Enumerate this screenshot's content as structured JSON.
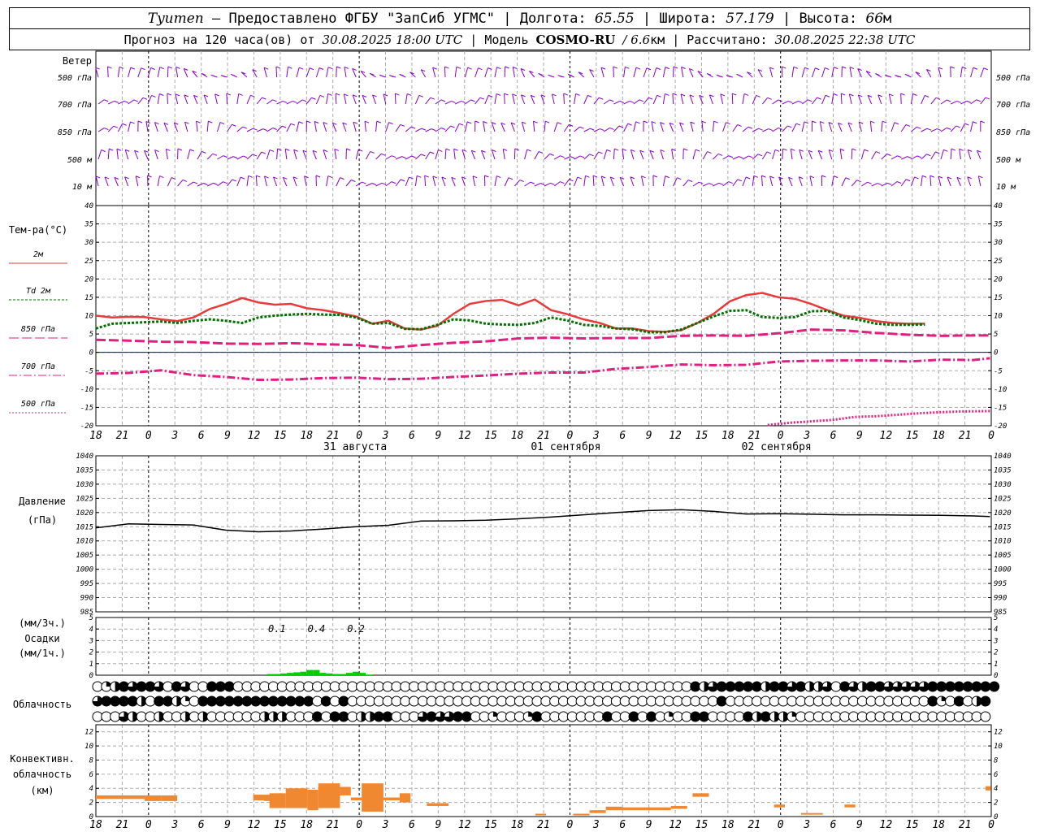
{
  "header": {
    "station": "Tyumen",
    "provider": "– Предоставлено ФГБУ \"ЗапСиб УГМС\"",
    "sep": "|",
    "lon_label": "Долгота:",
    "lon_value": "65.55",
    "lat_label": "Широта:",
    "lat_value": "57.179",
    "alt_label": "Высота:",
    "alt_value": "66",
    "alt_unit": "м",
    "forecast_label": "Прогноз на 120 часа(ов) от",
    "forecast_start": "30.08.2025 18:00 UTC",
    "model_label": "Модель",
    "model_name": "COSMO-RU",
    "model_res": "/ 6.6",
    "model_res_unit": "км",
    "calc_label": "Рассчитано:",
    "calc_time": "30.08.2025 22:38 UTC"
  },
  "colors": {
    "wind": "#8800cc",
    "t2m": "#e83a3a",
    "td2m": "#007000",
    "t850": "#e0207e",
    "t700": "#e0207e",
    "t500": "#e0207e",
    "zero_line": "#0000cc",
    "pressure": "#000000",
    "precip": "#00cc00",
    "conv": "#f08832",
    "grid": "#aaaaaa"
  },
  "chart_data": {
    "type": "line",
    "time_axis": {
      "start": "30.08.2025 18:00 UTC",
      "step_hours": 3,
      "tick_labels": [
        "18",
        "21",
        "0",
        "3",
        "6",
        "9",
        "12",
        "15",
        "18",
        "21",
        "0",
        "3",
        "6",
        "9",
        "12",
        "15",
        "18",
        "21",
        "0",
        "3",
        "6",
        "9",
        "12",
        "15",
        "18",
        "21",
        "0",
        "3",
        "6",
        "9",
        "12",
        "15",
        "18",
        "21",
        "0"
      ],
      "day_labels": [
        {
          "tick_index": 10,
          "text": "31 августа"
        },
        {
          "tick_index": 18,
          "text": "01 сентября"
        },
        {
          "tick_index": 26,
          "text": "02 сентября"
        }
      ],
      "hourly_x": [
        0,
        2,
        4,
        6,
        8,
        10,
        12,
        14,
        16,
        18,
        20,
        22,
        24,
        26,
        28,
        30,
        32,
        34,
        36,
        38,
        40,
        42,
        44,
        46,
        48,
        50,
        52,
        54,
        56,
        58,
        60,
        62,
        64,
        66,
        68,
        70,
        72,
        74,
        76,
        78,
        80,
        82,
        84,
        86,
        88,
        90,
        92,
        94,
        96,
        98,
        100,
        102,
        104,
        106,
        108,
        110,
        112,
        114,
        116,
        118,
        120,
        122,
        124,
        126,
        128,
        130,
        132,
        134,
        136,
        138,
        140,
        142,
        144,
        146,
        148,
        150,
        152,
        154,
        156,
        158
      ],
      "x_unit": "hours from start"
    },
    "wind": {
      "label": "Ветер",
      "levels": [
        "500 гПа",
        "700 гПа",
        "850 гПа",
        "500 м",
        "10   м"
      ]
    },
    "temperature": {
      "label": "Тем-ра(°C)",
      "ylim": [
        -20,
        40
      ],
      "yticks": [
        -20,
        -15,
        -10,
        -5,
        0,
        5,
        10,
        15,
        20,
        25,
        30,
        35,
        40
      ],
      "series": [
        {
          "name": "2м",
          "style": "solid",
          "x": [
            0,
            3,
            6,
            9,
            12,
            15,
            18,
            21,
            24,
            27,
            30,
            33,
            36,
            39,
            42,
            45,
            48,
            51,
            54,
            57,
            60,
            63,
            66,
            69,
            72,
            75,
            78,
            81,
            84,
            87,
            90,
            93,
            96,
            99,
            102,
            105,
            108,
            111,
            114,
            117,
            120,
            123,
            126,
            129,
            132,
            135,
            138,
            141,
            144,
            147,
            150,
            153,
            156,
            159,
            162,
            165
          ],
          "y": [
            10,
            9.5,
            9.7,
            9.6,
            9,
            8.5,
            9.5,
            11.8,
            13.2,
            14.8,
            13.6,
            13,
            13.2,
            12,
            11.5,
            10.7,
            9.8,
            7.8,
            8.6,
            6.5,
            6.2,
            7.2,
            10.5,
            13.2,
            14,
            14.3,
            12.8,
            14.4,
            11.5,
            10.4,
            9,
            8,
            6.5,
            6.5,
            5.8,
            5.6,
            6,
            8,
            10.5,
            13.9,
            15.6,
            16.2,
            15,
            14.6,
            13.2,
            11.5,
            10,
            9.4,
            8.5,
            8,
            7.8,
            7.8
          ]
        },
        {
          "name": "Td 2м",
          "style": "dotted",
          "x": [
            0,
            3,
            6,
            9,
            12,
            15,
            18,
            21,
            24,
            27,
            30,
            33,
            36,
            39,
            42,
            45,
            48,
            51,
            54,
            57,
            60,
            63,
            66,
            69,
            72,
            75,
            78,
            81,
            84,
            87,
            90,
            93,
            96,
            99,
            102,
            105,
            108,
            111,
            114,
            117,
            120,
            123,
            126,
            129,
            132,
            135,
            138,
            141,
            144,
            147,
            150,
            153,
            156,
            159,
            162,
            165
          ],
          "y": [
            6.5,
            7.8,
            8,
            8.2,
            8.4,
            8,
            8.6,
            9,
            8.6,
            8,
            9.5,
            10,
            10.3,
            10.5,
            10.3,
            10.2,
            9.5,
            7.8,
            8,
            6.4,
            6.3,
            7.5,
            9,
            8.7,
            7.8,
            7.6,
            7.5,
            8,
            9.5,
            8.7,
            7.5,
            7.2,
            6.5,
            6.3,
            5.5,
            5.5,
            6.2,
            8,
            9.8,
            11.3,
            11.5,
            9.6,
            9.4,
            9.6,
            11.2,
            11.3,
            9.5,
            8.8,
            7.8,
            7.5,
            7.5,
            7.6
          ]
        },
        {
          "name": "850 гПа",
          "style": "long-dash",
          "x": [
            0,
            6,
            12,
            18,
            24,
            30,
            36,
            42,
            48,
            54,
            60,
            66,
            72,
            78,
            84,
            90,
            96,
            102,
            108,
            114,
            120,
            126,
            132,
            138,
            144,
            150,
            156,
            162,
            165
          ],
          "y": [
            3.4,
            3.2,
            2.9,
            2.8,
            2.4,
            2.3,
            2.5,
            2.2,
            2.0,
            1.2,
            2.0,
            2.6,
            3.0,
            3.8,
            4.0,
            3.8,
            3.9,
            3.9,
            4.5,
            4.6,
            4.5,
            5.2,
            6.2,
            6.0,
            5.3,
            4.8,
            4.5,
            4.6,
            4.6
          ]
        },
        {
          "name": "700 гПа",
          "style": "dash-dot",
          "x": [
            0,
            6,
            12,
            18,
            24,
            30,
            36,
            42,
            48,
            54,
            60,
            66,
            72,
            78,
            84,
            90,
            96,
            102,
            108,
            114,
            120,
            126,
            132,
            138,
            144,
            150,
            156,
            162,
            165
          ],
          "y": [
            -5.8,
            -5.6,
            -4.9,
            -6.2,
            -6.7,
            -7.5,
            -7.4,
            -7.0,
            -6.9,
            -7.3,
            -7.2,
            -6.7,
            -6.3,
            -5.8,
            -5.5,
            -5.5,
            -4.5,
            -4.0,
            -3.3,
            -3.5,
            -3.4,
            -2.5,
            -2.3,
            -2.2,
            -2.2,
            -2.5,
            -2.0,
            -2.1,
            -1.6
          ]
        },
        {
          "name": "500 гПа",
          "style": "dotted",
          "x": [
            124,
            128,
            132,
            136,
            140,
            144,
            148,
            152,
            156,
            160,
            165
          ],
          "y": [
            -19.8,
            -19.2,
            -18.8,
            -18.4,
            -17.6,
            -17.4,
            -17.0,
            -16.6,
            -16.3,
            -16.1,
            -16.0
          ]
        }
      ]
    },
    "pressure": {
      "label": "Давление",
      "unit": "(гПа)",
      "ylim": [
        985,
        1040
      ],
      "yticks": [
        985,
        990,
        995,
        1000,
        1005,
        1010,
        1015,
        1020,
        1025,
        1030,
        1035,
        1040
      ],
      "x": [
        0,
        6,
        12,
        18,
        24,
        30,
        36,
        42,
        48,
        54,
        60,
        66,
        72,
        78,
        84,
        90,
        96,
        102,
        108,
        114,
        120,
        126,
        132,
        138,
        144,
        150,
        156,
        162,
        165
      ],
      "y": [
        1014.6,
        1016.0,
        1015.8,
        1015.6,
        1013.8,
        1013.2,
        1013.5,
        1014.2,
        1015.0,
        1015.5,
        1017.0,
        1017.1,
        1017.3,
        1017.8,
        1018.4,
        1019.2,
        1020.0,
        1020.7,
        1021.0,
        1020.4,
        1019.5,
        1019.6,
        1019.4,
        1019.2,
        1019.2,
        1019.1,
        1019.0,
        1018.8,
        1018.6
      ]
    },
    "precip": {
      "unit_3h": "(мм/3ч.)",
      "label": "Осадки",
      "unit_1h": "(мм/1ч.)",
      "ylim": [
        0,
        5
      ],
      "yticks": [
        0,
        1,
        2,
        3,
        4,
        5
      ],
      "totals": [
        {
          "x": 27,
          "text": "0.1"
        },
        {
          "x": 33,
          "text": "0.4"
        },
        {
          "x": 39,
          "text": "0.2"
        }
      ],
      "x": [
        26,
        27,
        28,
        29,
        30,
        31,
        32,
        33,
        34,
        35,
        36,
        37,
        38,
        39,
        40,
        41
      ],
      "y": [
        0.1,
        0.1,
        0.15,
        0.2,
        0.25,
        0.3,
        0.45,
        0.45,
        0.2,
        0.15,
        0.1,
        0.1,
        0.2,
        0.3,
        0.2,
        0.05
      ]
    },
    "clouds": {
      "label": "Облачность",
      "rows": [
        "0124344304300444000000000000000000000000000000000000000000000000000042344444244342230432443333344444444",
        "344442044210444444444444404040000000000000000000000000000000000000000004000000000000000000000004104024",
        "000320020020200000022200040440224400034334400100014000000040040401004400004242210000000000000000000000"
      ]
    },
    "convective": {
      "label_1": "Конвективн.",
      "label_2": "облачность",
      "label_3": "(км)",
      "ylim": [
        0,
        13
      ],
      "yticks": [
        0,
        2,
        4,
        6,
        8,
        10,
        12
      ],
      "cells": [
        [
          0,
          9,
          2.5,
          3
        ],
        [
          9,
          12,
          2.2,
          3
        ],
        [
          12,
          15,
          2.2,
          3
        ],
        [
          29,
          31,
          2.3,
          3.1
        ],
        [
          31,
          33,
          2.2,
          3.1
        ],
        [
          32,
          35,
          1.2,
          3.3
        ],
        [
          35,
          39,
          1.2,
          4.0
        ],
        [
          39,
          41,
          0.9,
          3.8
        ],
        [
          41,
          45,
          1.2,
          4.7
        ],
        [
          45,
          47,
          3.0,
          4.2
        ],
        [
          47,
          49,
          2.3,
          2.7
        ],
        [
          49,
          53,
          0.7,
          4.7
        ],
        [
          53,
          56,
          2.3,
          2.7
        ],
        [
          56,
          58,
          2.0,
          3.3
        ],
        [
          61,
          65,
          1.5,
          1.9
        ],
        [
          81,
          83,
          0.2,
          0.4
        ],
        [
          88,
          91,
          0.2,
          0.4
        ],
        [
          91,
          94,
          0.5,
          0.9
        ],
        [
          94,
          97,
          0.9,
          1.4
        ],
        [
          97,
          106,
          0.9,
          1.3
        ],
        [
          106,
          109,
          1.1,
          1.5
        ],
        [
          110,
          113,
          2.8,
          3.3
        ],
        [
          125,
          127,
          1.3,
          1.7
        ],
        [
          130,
          134,
          0.3,
          0.5
        ],
        [
          138,
          140,
          1.3,
          1.7
        ],
        [
          164,
          165,
          3.7,
          4.3
        ]
      ]
    }
  }
}
